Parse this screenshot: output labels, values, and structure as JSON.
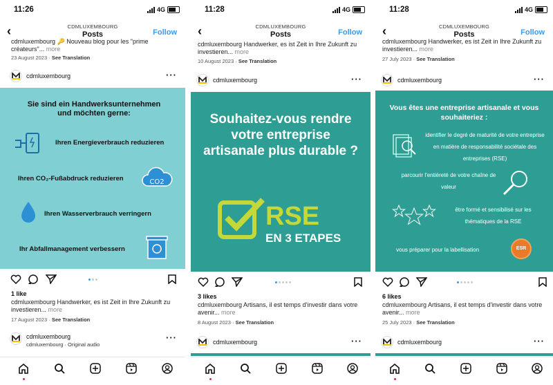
{
  "status": {
    "time1": "11:26",
    "time2": "11:28",
    "time3": "11:28",
    "network": "4G"
  },
  "header": {
    "account": "CDMLUXEMBOURG",
    "title": "Posts",
    "follow": "Follow",
    "back_icon": "chevron-left-icon"
  },
  "screens": [
    {
      "prev_caption": "cdmluxembourg 🔑 Nouveau blog pour les \"prime créateurs\"...",
      "prev_more": "more",
      "prev_date": "23 August 2023",
      "prev_translation": "See Translation",
      "username": "cdmluxembourg",
      "slide": {
        "title": "Sie sind ein Handwerksunternehmen und möchten gerne:",
        "item1": "Ihren Energieverbrauch reduzieren",
        "item2": "Ihren CO₂-Fußabdruck reduzieren",
        "item3": "Ihren Wasserverbrauch verringern",
        "item4": "Ihr Abfallmanagement verbessern",
        "cloud_label": "CO2",
        "bg": "#7fcfd3"
      },
      "likes": "1 like",
      "caption": "cdmluxembourg Handwerker, es ist Zeit in Ihre Zukunft zu investieren...",
      "more": "more",
      "date": "17 August 2023",
      "translation": "See Translation",
      "next_username": "cdmluxembourg",
      "next_sub": "cdmluxembourg · Original audio"
    },
    {
      "prev_caption": "cdmluxembourg Handwerker, es ist Zeit in Ihre Zukunft zu investieren...",
      "prev_more": "more",
      "prev_date": "10 August 2023",
      "prev_translation": "See Translation",
      "username": "cdmluxembourg",
      "slide": {
        "title": "Souhaitez-vous rendre votre entreprise artisanale plus durable ?",
        "rse": "RSE",
        "steps": "EN 3 ETAPES",
        "bg": "#2e9e94"
      },
      "likes": "3 likes",
      "caption": "cdmluxembourg Artisans, il est temps d'investir dans votre avenir...",
      "more": "more",
      "date": "8 August 2023",
      "translation": "See Translation",
      "next_username": "cdmluxembourg"
    },
    {
      "prev_caption": "cdmluxembourg Handwerker, es ist Zeit in Ihre Zukunft zu investieren...",
      "prev_more": "more",
      "prev_date": "27 July 2023",
      "prev_translation": "See Translation",
      "username": "cdmluxembourg",
      "slide": {
        "title": "Vous êtes une entreprise artisanale et vous souhaiteriez :",
        "item1": "identifier le degré de maturité de votre entreprise en matière de responsabilité sociétale des entreprises (RSE)",
        "item2": "parcourir l'entièreté de votre chaîne de valeur",
        "item3": "être formé et sensibilisé sur les thématiques de la RSE",
        "item4": "vous préparer pour la labellisation",
        "badge": "ESR",
        "bg": "#2e9e94"
      },
      "likes": "6 likes",
      "caption": "cdmluxembourg Artisans, il est temps d'investir dans votre avenir...",
      "more": "more",
      "date": "25 July 2023",
      "translation": "See Translation",
      "next_username": "cdmluxembourg"
    }
  ],
  "tabs": [
    "home-icon",
    "search-icon",
    "create-icon",
    "reels-icon",
    "profile-icon"
  ]
}
